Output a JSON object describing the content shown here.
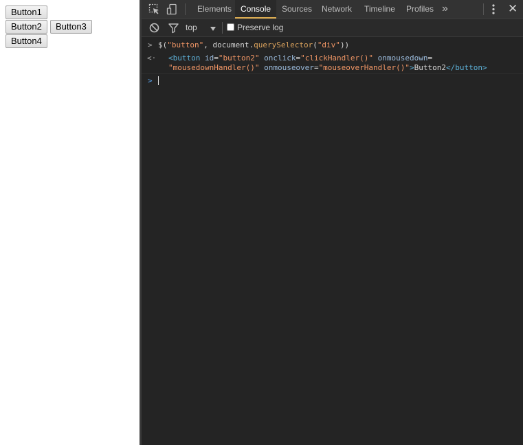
{
  "page": {
    "buttons": [
      "Button1",
      "Button2",
      "Button3",
      "Button4"
    ]
  },
  "devtools": {
    "tabs": [
      "Elements",
      "Console",
      "Sources",
      "Network",
      "Timeline",
      "Profiles"
    ],
    "active_tab": "Console",
    "more_tabs_glyph": "»",
    "close_glyph": "✕",
    "toolbar": {
      "context": "top",
      "preserve_log_label": "Preserve log",
      "preserve_log_checked": false
    },
    "console": {
      "input_prompt": ">",
      "output_prompt": "<·",
      "active_prompt": ">",
      "command": {
        "p1": "$(",
        "s1": "\"button\"",
        "p2": ", document.",
        "f1": "querySelector",
        "p3": "(",
        "s2": "\"div\"",
        "p4": "))"
      },
      "result": {
        "open": "<button",
        "a1": "id",
        "v1": "\"button2\"",
        "a2": "onclick",
        "v2": "\"clickHandler()\"",
        "a3": "onmousedown",
        "eq": "=",
        "v3": "\"mousedownHandler()\"",
        "a4": "onmouseover",
        "v4": "\"mouseoverHandler()\"",
        "close_bracket": ">",
        "text": "Button2",
        "close": "</button>"
      }
    },
    "colors": {
      "active_tab_underline": "#ddad52",
      "string": "#f29766",
      "tag": "#5db0d7",
      "attr": "#9bbbdc",
      "background": "#242424"
    }
  }
}
